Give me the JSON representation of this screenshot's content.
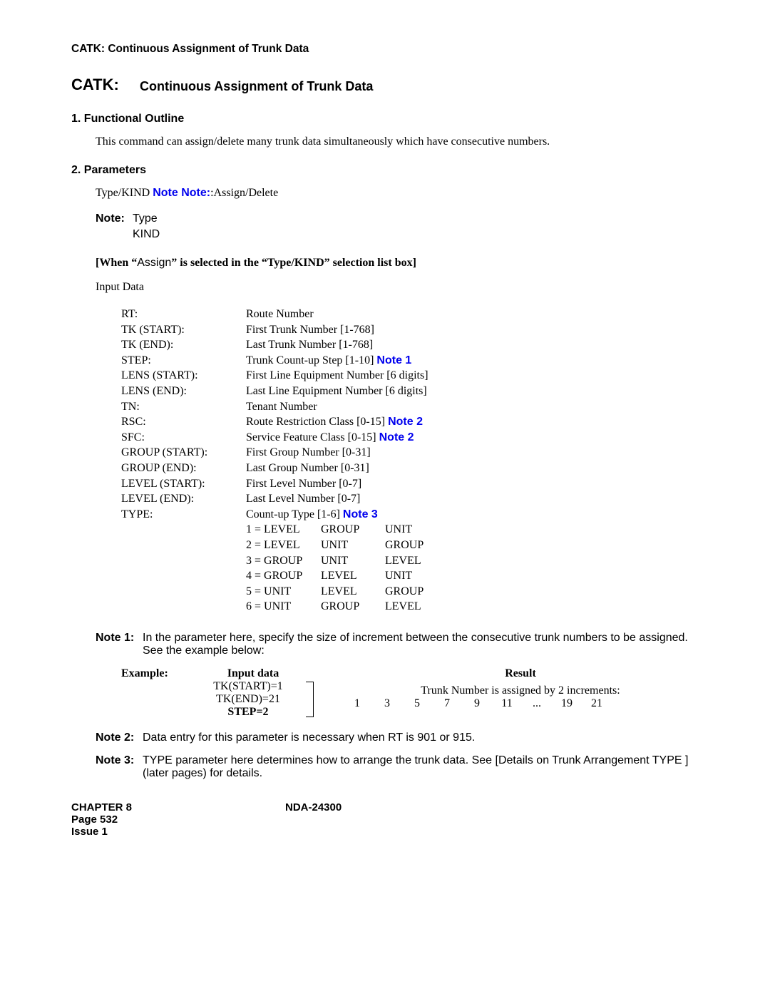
{
  "header": "CATK:  Continuous Assignment of Trunk Data",
  "title": {
    "catk": "CATK:",
    "rest": "Continuous Assignment of Trunk Data"
  },
  "section1": {
    "head": "1.   Functional Outline",
    "body": "This command can assign/delete many trunk data simultaneously which have consecutive numbers."
  },
  "section2": {
    "head": "2.   Parameters",
    "typekind_pre": "Type/KIND ",
    "typekind_link": "Note Note:",
    "typekind_post": ":Assign/Delete",
    "note_label": "Note:",
    "note_line1": "Type",
    "note_line2": "KIND",
    "when_line_pre": "[When “",
    "when_line_assign": "Assign",
    "when_line_post": "” is selected in the “Type/KIND” selection list box]",
    "input_data": "Input Data"
  },
  "params": [
    {
      "label": "RT:",
      "desc": "Route Number"
    },
    {
      "label": "TK (START):",
      "desc": "First Trunk Number [1-768]"
    },
    {
      "label": "TK (END):",
      "desc": "Last Trunk Number [1-768]"
    },
    {
      "label": "STEP:",
      "desc_pre": "Trunk Count-up Step [1-10] ",
      "desc_link": "Note 1"
    },
    {
      "label": "LENS (START):",
      "desc": "First Line Equipment Number [6 digits]"
    },
    {
      "label": "LENS (END):",
      "desc": "Last Line Equipment Number [6 digits]"
    },
    {
      "label": "TN:",
      "desc": "Tenant Number"
    },
    {
      "label": "RSC:",
      "desc_pre": "Route Restriction Class [0-15] ",
      "desc_link": "Note 2"
    },
    {
      "label": "SFC:",
      "desc_pre": "Service Feature Class [0-15] ",
      "desc_link": "Note 2"
    },
    {
      "label": "GROUP (START):",
      "desc": "First Group Number [0-31]"
    },
    {
      "label": "GROUP (END):",
      "desc": "Last Group Number [0-31]"
    },
    {
      "label": "LEVEL (START):",
      "desc": "First Level Number [0-7]"
    },
    {
      "label": "LEVEL (END):",
      "desc": "Last Level Number [0-7]"
    },
    {
      "label": "TYPE:",
      "desc_pre": "Count-up Type [1-6] ",
      "desc_link": "Note 3"
    }
  ],
  "types": [
    {
      "c1": "1 = LEVEL",
      "c2": "GROUP",
      "c3": "UNIT"
    },
    {
      "c1": "2 = LEVEL",
      "c2": "UNIT",
      "c3": "GROUP"
    },
    {
      "c1": "3 = GROUP",
      "c2": "UNIT",
      "c3": "LEVEL"
    },
    {
      "c1": "4 = GROUP",
      "c2": "LEVEL",
      "c3": "UNIT"
    },
    {
      "c1": "5 = UNIT",
      "c2": "LEVEL",
      "c3": "GROUP"
    },
    {
      "c1": "6 = UNIT",
      "c2": "GROUP",
      "c3": "LEVEL"
    }
  ],
  "note1": {
    "label": "Note 1:",
    "body": "In the parameter here, specify the size of increment between the consecutive trunk numbers to be assigned. See the example below:"
  },
  "example": {
    "label": "Example:",
    "input_head": "Input data",
    "lines": [
      "TK(START)=1",
      "TK(END)=21",
      "STEP=2"
    ],
    "result_head": "Result",
    "result_desc": "Trunk Number is assigned by 2 increments:",
    "nums": [
      "1",
      "3",
      "5",
      "7",
      "9",
      "11",
      "...",
      "19",
      "21"
    ]
  },
  "note2": {
    "label": "Note 2:",
    "pre": "Data entry for this parameter is necessary when ",
    "rt": "RT",
    "post": "  is   901   or   915."
  },
  "note3": {
    "label": "Note 3:",
    "pre": " TYPE  parameter here determines how to arrange the trunk data. ",
    "see": "See ",
    "link": "[Details on Trunk Arrangement TYPE ]  (later pages) ",
    "post": "for details."
  },
  "footer": {
    "chapter": "CHAPTER 8",
    "page": "Page 532",
    "issue": "Issue 1",
    "doc": "NDA-24300"
  }
}
